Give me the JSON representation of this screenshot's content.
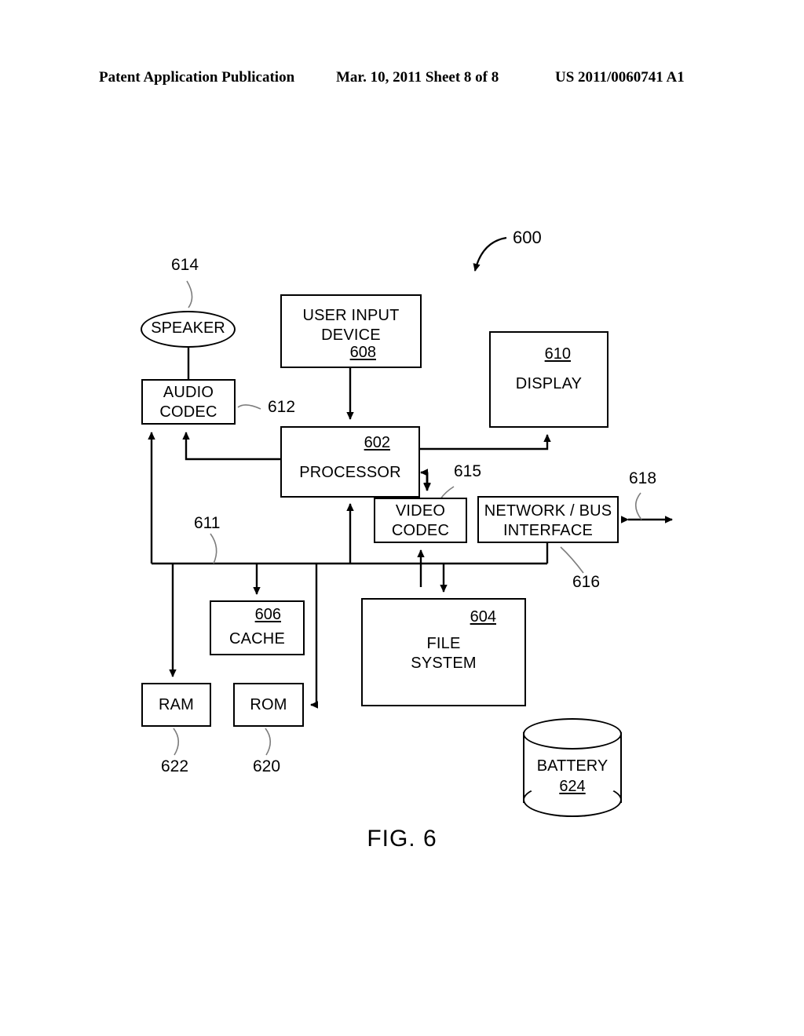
{
  "header": {
    "left": "Patent Application Publication",
    "center": "Mar. 10, 2011  Sheet 8 of 8",
    "right": "US 2011/0060741 A1"
  },
  "figure": {
    "caption": "FIG. 6",
    "system_ref": "600"
  },
  "blocks": {
    "user_input_device": {
      "line1": "USER INPUT",
      "line2": "DEVICE",
      "ref": "608"
    },
    "display": {
      "line1": "DISPLAY",
      "ref": "610"
    },
    "speaker": {
      "line1": "SPEAKER",
      "ref": "614"
    },
    "audio_codec": {
      "line1": "AUDIO",
      "line2": "CODEC",
      "ref": "612"
    },
    "processor": {
      "line1": "PROCESSOR",
      "ref": "602"
    },
    "video_codec": {
      "line1": "VIDEO",
      "line2": "CODEC",
      "ref": "615"
    },
    "network_bus_interface": {
      "line1": "NETWORK / BUS",
      "line2": "INTERFACE",
      "ref": "616"
    },
    "cache": {
      "line1": "CACHE",
      "ref": "606"
    },
    "file_system": {
      "line1": "FILE",
      "line2": "SYSTEM",
      "ref": "604"
    },
    "ram": {
      "line1": "RAM",
      "ref": "622"
    },
    "rom": {
      "line1": "ROM",
      "ref": "620"
    },
    "battery": {
      "line1": "BATTERY",
      "ref": "624"
    }
  },
  "connections": {
    "bus_ref": "611",
    "external_io_ref": "618"
  }
}
